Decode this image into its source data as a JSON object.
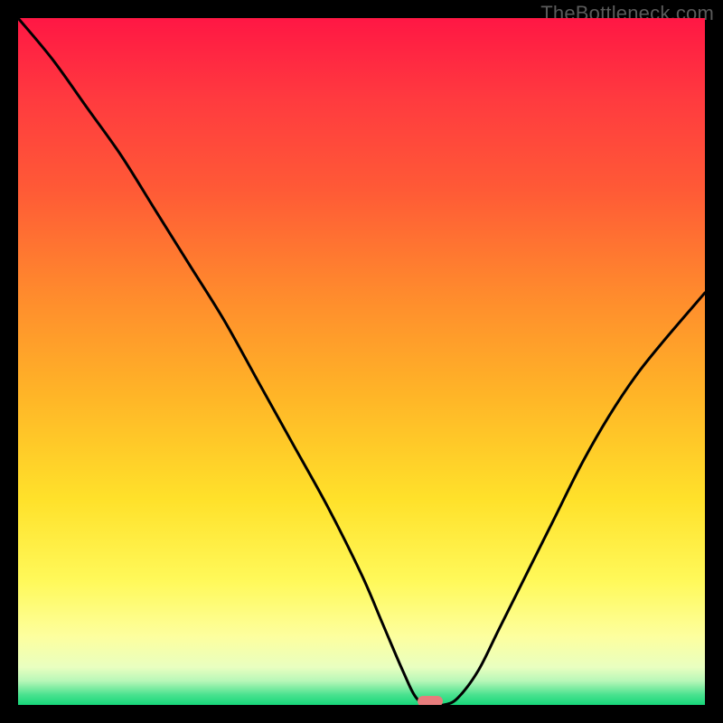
{
  "watermark": "TheBottleneck.com",
  "chart_data": {
    "type": "line",
    "title": "",
    "subtitle": "",
    "xlabel": "",
    "ylabel": "",
    "xlim": [
      0,
      100
    ],
    "ylim": [
      0,
      100
    ],
    "grid": false,
    "legend": false,
    "note": "No numeric tick labels or axis labels are visible; values are estimated from curve geometry relative to the plot frame.",
    "series": [
      {
        "name": "bottleneck-curve",
        "x": [
          0,
          5,
          10,
          15,
          20,
          25,
          30,
          35,
          40,
          45,
          50,
          53,
          56,
          58,
          60,
          62,
          64,
          67,
          70,
          74,
          78,
          82,
          86,
          90,
          94,
          100
        ],
        "y": [
          100,
          94,
          87,
          80,
          72,
          64,
          56,
          47,
          38,
          29,
          19,
          12,
          5,
          1,
          0,
          0,
          1,
          5,
          11,
          19,
          27,
          35,
          42,
          48,
          53,
          60
        ]
      }
    ],
    "marker": {
      "name": "optimum-marker",
      "x": 60,
      "y": 0,
      "color": "#e77c7c"
    },
    "gradient_stops": [
      {
        "offset": 0.0,
        "color": "#ff1744"
      },
      {
        "offset": 0.12,
        "color": "#ff3b3f"
      },
      {
        "offset": 0.25,
        "color": "#ff5a36"
      },
      {
        "offset": 0.4,
        "color": "#ff8a2d"
      },
      {
        "offset": 0.55,
        "color": "#ffb527"
      },
      {
        "offset": 0.7,
        "color": "#ffe12a"
      },
      {
        "offset": 0.82,
        "color": "#fff95a"
      },
      {
        "offset": 0.9,
        "color": "#fdff9e"
      },
      {
        "offset": 0.945,
        "color": "#e9ffc0"
      },
      {
        "offset": 0.965,
        "color": "#b8f7b8"
      },
      {
        "offset": 0.985,
        "color": "#4be28f"
      },
      {
        "offset": 1.0,
        "color": "#16d67a"
      }
    ]
  }
}
